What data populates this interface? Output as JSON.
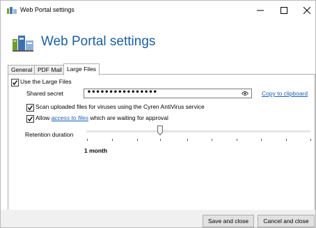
{
  "window": {
    "title": "Web Portal settings"
  },
  "header": {
    "title": "Web Portal settings"
  },
  "tabs": [
    {
      "label": "General",
      "active": false
    },
    {
      "label": "PDF Mail",
      "active": false
    },
    {
      "label": "Large Files",
      "active": true
    }
  ],
  "large_files": {
    "use_large_files": {
      "label": "Use the Large Files",
      "checked": true
    },
    "shared_secret": {
      "label": "Shared secret",
      "value": "••••••••••••••••",
      "copy_link": "Copy to clipboard"
    },
    "scan_viruses": {
      "label": "Scan uploaded files for viruses using the Cyren AntiVirus service",
      "checked": true
    },
    "allow_access": {
      "prefix": "Allow ",
      "link": "access to files",
      "suffix": " which are waiting for approval",
      "checked": true
    },
    "retention": {
      "label": "Retention duration",
      "value_label": "1 month",
      "position_fraction": 0.34
    }
  },
  "footer": {
    "save_label": "Save and close",
    "cancel_label": "Cancel and close"
  },
  "colors": {
    "accent": "#1b5fa1",
    "link": "#1a5fb4"
  },
  "icons": [
    "app-icon",
    "minimize-icon",
    "maximize-icon",
    "close-icon",
    "portal-header-icon",
    "check-icon",
    "eye-icon",
    "slider-thumb-icon"
  ]
}
